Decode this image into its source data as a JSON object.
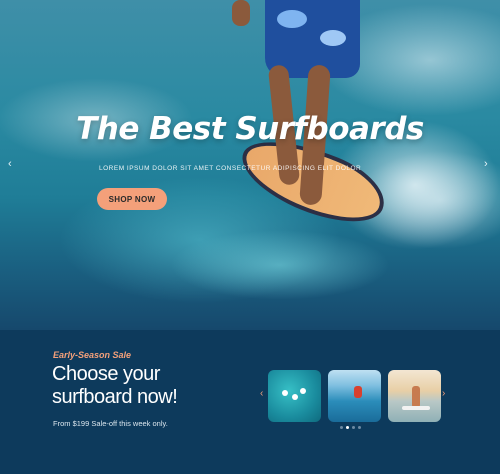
{
  "hero": {
    "title": "The Best Surfboards",
    "subtitle": "LOREM IPSUM DOLOR SIT AMET CONSECTETUR ADIPISCING ELIT DOLOR",
    "cta_label": "SHOP NOW",
    "prev_arrow": "‹",
    "next_arrow": "›"
  },
  "sale": {
    "tag": "Early-Season Sale",
    "heading_line1": "Choose your",
    "heading_line2": "surfboard now!",
    "note": "From $199 Sale-off this week only.",
    "prev_arrow": "‹",
    "next_arrow": "›",
    "thumbnails": [
      "surfers-aerial",
      "wave-rider",
      "beach-surfer"
    ],
    "pager_count": 4,
    "pager_active": 2
  },
  "colors": {
    "accent": "#f4a07a",
    "section_bg": "#0d3a5c"
  }
}
